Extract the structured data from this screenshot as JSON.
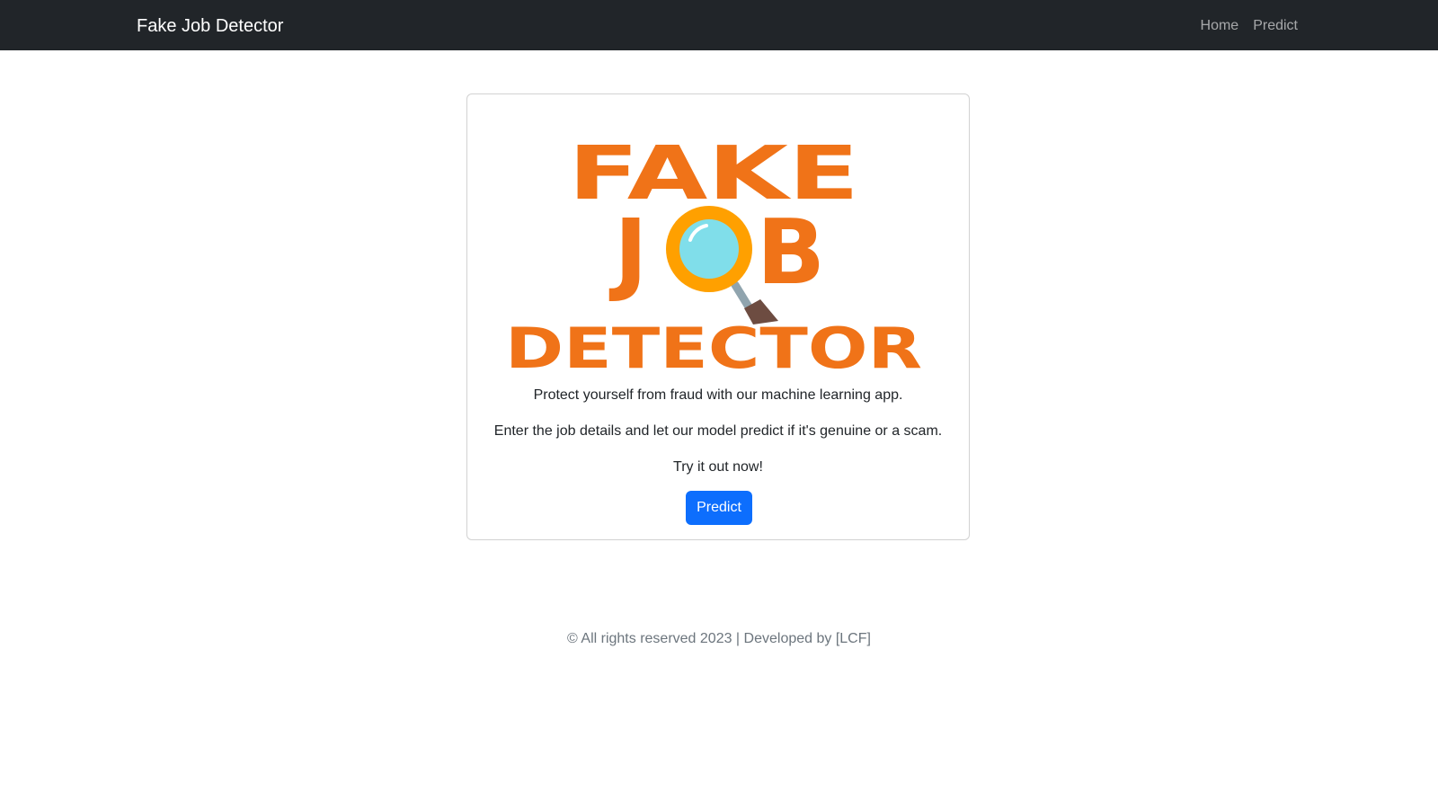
{
  "navbar": {
    "brand": "Fake Job Detector",
    "links": [
      "Home",
      "Predict"
    ]
  },
  "card": {
    "logo": {
      "word1": "FAKE",
      "word2_start": "J",
      "word2_end": "B",
      "word3": "DETECTOR"
    },
    "lines": [
      "Protect yourself from fraud with our machine learning app.",
      "Enter the job details and let our model predict if it's genuine or a scam.",
      "Try it out now!"
    ],
    "button_label": "Predict"
  },
  "footer": {
    "text": "© All rights reserved 2023 | Developed by [LCF]"
  },
  "colors": {
    "navbar_bg": "#212529",
    "logo_orange": "#f07318",
    "lens_ring": "#ffa000",
    "lens_glass": "#80deea",
    "handle": "#6d4c41",
    "button_bg": "#0d6efd"
  }
}
